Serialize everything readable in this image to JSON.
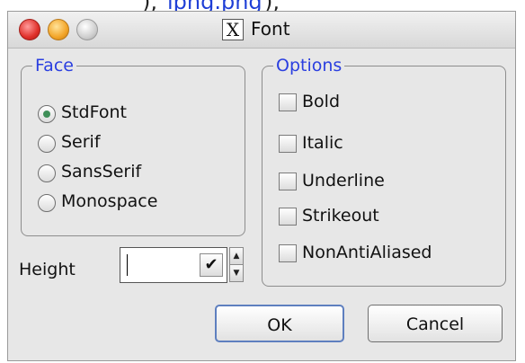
{
  "top_strip": {
    "link_text": "ipng.png",
    "left_punct": "),",
    "right_punct": "),"
  },
  "window": {
    "title": "Font",
    "title_icon": "x-window-icon"
  },
  "face": {
    "legend": "Face",
    "options": [
      {
        "label": "StdFont",
        "checked": true
      },
      {
        "label": "Serif",
        "checked": false
      },
      {
        "label": "SansSerif",
        "checked": false
      },
      {
        "label": "Monospace",
        "checked": false
      }
    ]
  },
  "options": {
    "legend": "Options",
    "items": [
      {
        "label": "Bold",
        "checked": false
      },
      {
        "label": "Italic",
        "checked": false
      },
      {
        "label": "Underline",
        "checked": false
      },
      {
        "label": "Strikeout",
        "checked": false
      },
      {
        "label": "NonAntiAliased",
        "checked": false
      }
    ]
  },
  "height": {
    "label": "Height",
    "value": ""
  },
  "buttons": {
    "ok": "OK",
    "cancel": "Cancel"
  },
  "colors": {
    "legend": "#2b3fe0",
    "window_bg": "#e7e7e7",
    "radio_dot": "#3f8f58"
  }
}
